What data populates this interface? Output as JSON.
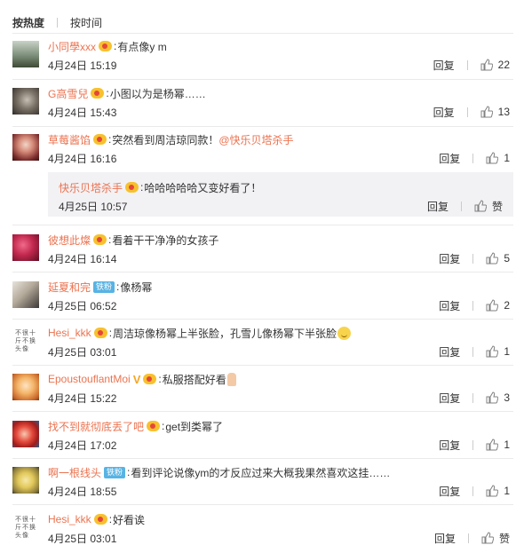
{
  "tabs": {
    "hot": "按热度",
    "time": "按时间"
  },
  "comments": [
    {
      "user": "小同學xxx",
      "text": "有点像y m",
      "time": "4月24日 15:19",
      "reply": "回复",
      "likes": "22"
    },
    {
      "user": "G高雪兒",
      "text": "小图以为是杨幂……",
      "time": "4月24日 15:43",
      "reply": "回复",
      "likes": "13"
    },
    {
      "user": "草莓酱馅",
      "text": "突然看到周洁琼同款！",
      "mention": "@快乐贝塔杀手",
      "time": "4月24日 16:16",
      "reply": "回复",
      "likes": "1",
      "sub": {
        "user": "快乐贝塔杀手",
        "text": "哈哈哈哈哈又变好看了！",
        "time": "4月25日 10:57",
        "reply": "回复",
        "likes": "赞"
      }
    },
    {
      "user": "彼想此燦",
      "text": "看着干干净净的女孩子",
      "time": "4月24日 16:14",
      "reply": "回复",
      "likes": "5"
    },
    {
      "user": "延夏和完",
      "badge": "铁粉",
      "text": "像杨幂",
      "time": "4月25日 06:52",
      "reply": "回复",
      "likes": "2"
    },
    {
      "user": "Hesi_kkk",
      "avatar_text": "不很十斤不换头像",
      "text": "周洁琼像杨幂上半张脸，孔雪儿像杨幂下半张脸",
      "time": "4月25日 03:01",
      "reply": "回复",
      "likes": "1"
    },
    {
      "user": "EpoustouflantMoi",
      "vmark": "V",
      "text": "私服搭配好看",
      "time": "4月24日 15:22",
      "reply": "回复",
      "likes": "3"
    },
    {
      "user": "找不到就彻底丢了吧",
      "text": "get到类幂了",
      "time": "4月24日 17:02",
      "reply": "回复",
      "likes": "1"
    },
    {
      "user": "啊一根线头",
      "badge": "铁粉",
      "text": "看到评论说像ym的才反应过来大概我果然喜欢这挂……",
      "time": "4月24日 18:55",
      "reply": "回复",
      "likes": "1"
    },
    {
      "user": "Hesi_kkk",
      "avatar_text": "不很十斤不换头像",
      "text": "好看诶",
      "time": "4月25日 03:01",
      "reply": "回复",
      "likes": "赞"
    }
  ],
  "colors": {
    "username": "#eb7350",
    "fan_badge": "#58b3e3",
    "divider": "#eaeaea",
    "subbox_bg": "#f2f2f5"
  }
}
